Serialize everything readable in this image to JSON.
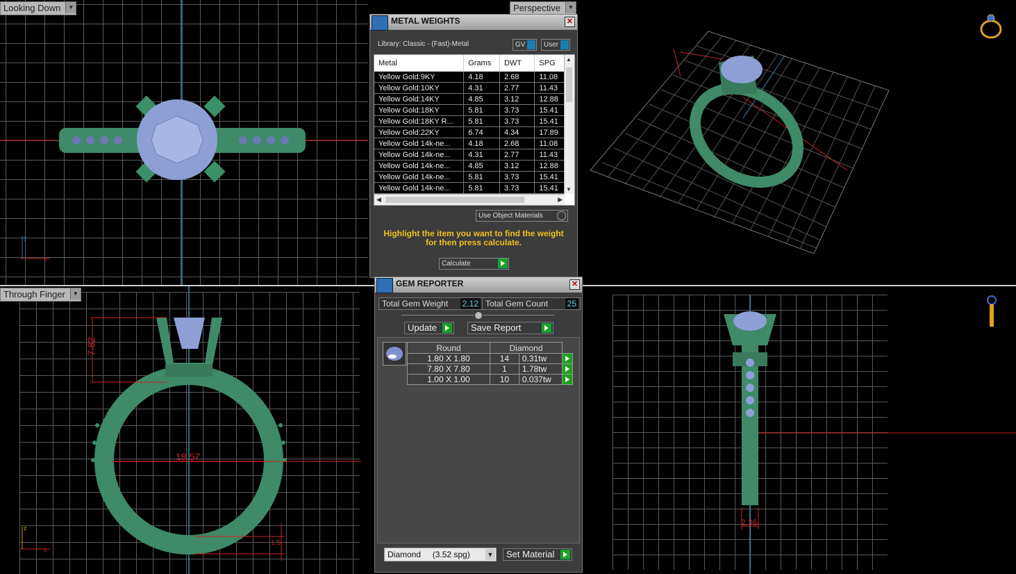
{
  "viewports": {
    "top_left": {
      "label": "Looking Down",
      "axis_x": "x",
      "axis_y": "y"
    },
    "top_right": {
      "label": "Perspective"
    },
    "bottom_left": {
      "label": "Through Finger",
      "axis_x": "x",
      "axis_y": "z",
      "dim_height": "7.82",
      "dim_width": "18.57",
      "dim_small": "1.5"
    },
    "bottom_right": {
      "dim_width": "2.36"
    }
  },
  "metal_weights": {
    "title": "METAL WEIGHTS",
    "library": "Library: Classic - (Fast)-Metal",
    "toggle_gv": "GV",
    "toggle_user": "User",
    "columns": [
      "Metal",
      "Grams",
      "DWT",
      "SPG"
    ],
    "rows": [
      [
        "Yellow Gold:9KY",
        "4.18",
        "2.68",
        "11.08"
      ],
      [
        "Yellow Gold:10KY",
        "4.31",
        "2.77",
        "11.43"
      ],
      [
        "Yellow Gold:14KY",
        "4.85",
        "3.12",
        "12.88"
      ],
      [
        "Yellow Gold:18KY",
        "5.81",
        "3.73",
        "15.41"
      ],
      [
        "Yellow Gold:18KY R...",
        "5.81",
        "3.73",
        "15.41"
      ],
      [
        "Yellow Gold:22KY",
        "6.74",
        "4.34",
        "17.89"
      ],
      [
        "Yellow Gold 14k-ne...",
        "4.18",
        "2.68",
        "11.08"
      ],
      [
        "Yellow Gold 14k-ne...",
        "4.31",
        "2.77",
        "11.43"
      ],
      [
        "Yellow Gold 14k-ne...",
        "4.85",
        "3.12",
        "12.88"
      ],
      [
        "Yellow Gold 14k-ne...",
        "5.81",
        "3.73",
        "15.41"
      ],
      [
        "Yellow Gold 14k-ne...",
        "5.81",
        "3.73",
        "15.41"
      ]
    ],
    "use_object_materials": "Use Object Materials",
    "hint": "Highlight the item you want to find the weight for then press calculate.",
    "calculate": "Calculate"
  },
  "gem_reporter": {
    "title": "GEM REPORTER",
    "total_weight_label": "Total Gem Weight",
    "total_weight_value": "2.12",
    "total_count_label": "Total Gem Count",
    "total_count_value": "25",
    "update": "Update",
    "save_report": "Save Report",
    "columns": [
      "Round",
      "Diamond"
    ],
    "rows": [
      [
        "1.80 X 1.80",
        "14",
        "0.31tw"
      ],
      [
        "7.80 X 7.80",
        "1",
        "1.78tw"
      ],
      [
        "1.00 X 1.00",
        "10",
        "0.037tw"
      ]
    ],
    "material_select": "Diamond     (3.52 spg)",
    "set_material": "Set Material"
  },
  "colors": {
    "ring": "#3f8a68",
    "gem": "#8e9fd6",
    "dimension": "#d0201a",
    "hint": "#f0c020"
  }
}
